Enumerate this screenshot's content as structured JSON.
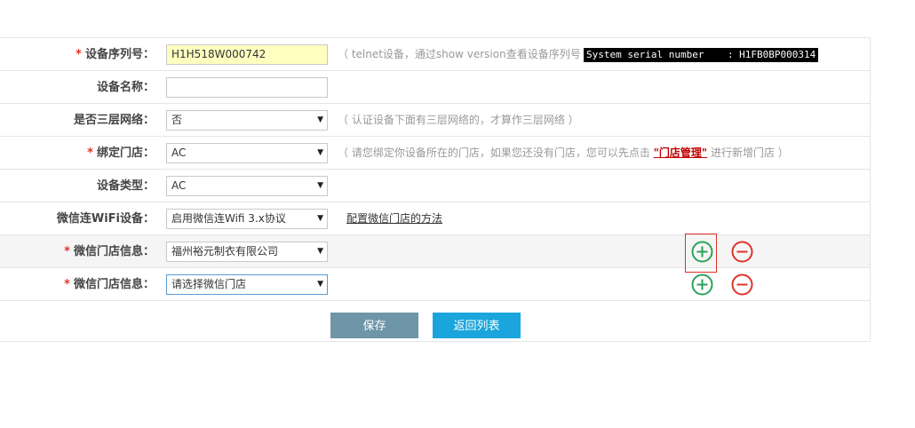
{
  "rows": [
    {
      "label": "设备序列号：",
      "required": true,
      "value": "H1H518W000742",
      "hint": "（ telnet设备，通过show version查看设备序列号 ）",
      "serial": "System serial number    : H1FB0BP000314"
    },
    {
      "label": "设备名称：",
      "required": false,
      "value": ""
    },
    {
      "label": "是否三层网络：",
      "required": false,
      "value": "否",
      "hint": "（ 认证设备下面有三层网络的，才算作三层网络 ）"
    },
    {
      "label": "绑定门店：",
      "required": true,
      "value": "AC",
      "hint_before": "（ 请您绑定你设备所在的门店，如果您还没有门店，您可以先点击 ",
      "hint_link": "\"门店管理\"",
      "hint_after": " 进行新增门店 ）"
    },
    {
      "label": "设备类型：",
      "required": false,
      "value": "AC"
    },
    {
      "label": "微信连WiFi设备：",
      "required": false,
      "value": "启用微信连Wifi 3.x协议",
      "link": "配置微信门店的方法"
    },
    {
      "label": "微信门店信息：",
      "required": true,
      "value": "福州裕元制衣有限公司"
    },
    {
      "label": "微信门店信息：",
      "required": true,
      "value": "请选择微信门店"
    }
  ],
  "buttons": {
    "save": "保存",
    "back": "返回列表"
  },
  "colors": {
    "required": "#e0332a",
    "plus": "#2aa35a",
    "minus": "#e0332a",
    "save": "#6e95a8",
    "back": "#1aa6dc"
  }
}
